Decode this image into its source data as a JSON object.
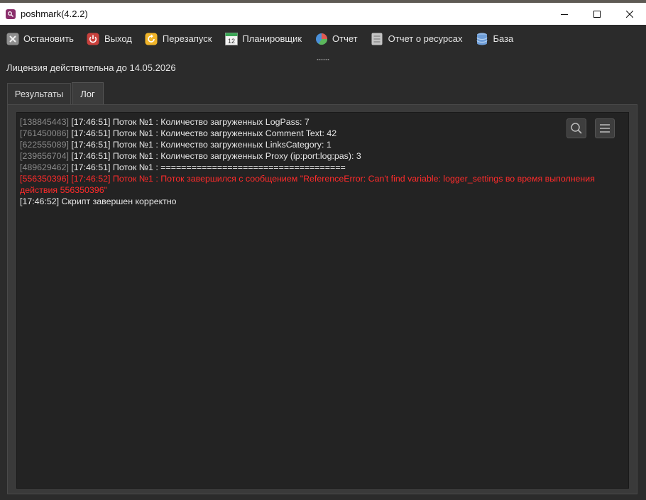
{
  "window": {
    "title": "poshmark(4.2.2)",
    "minimize_icon": "minimize-icon",
    "maximize_icon": "maximize-icon",
    "close_icon": "close-icon"
  },
  "toolbar": {
    "items": [
      {
        "label": "Остановить",
        "icon": "stop-icon",
        "color": "#9a9a9a"
      },
      {
        "label": "Выход",
        "icon": "power-icon",
        "color": "#d9534f"
      },
      {
        "label": "Перезапуск",
        "icon": "restart-icon",
        "color": "#f0b429"
      },
      {
        "label": "Планировщик",
        "icon": "calendar-icon",
        "color": "#3aa655"
      },
      {
        "label": "Отчет",
        "icon": "pie-chart-icon",
        "color": "#e05a4f"
      },
      {
        "label": "Отчет о ресурсах",
        "icon": "document-icon",
        "color": "#bdbdbd"
      },
      {
        "label": "База",
        "icon": "database-icon",
        "color": "#6f9ed8"
      }
    ]
  },
  "license_text": "Лицензия действительна до 14.05.2026",
  "tabs": [
    {
      "label": "Результаты",
      "active": false
    },
    {
      "label": "Лог",
      "active": true
    }
  ],
  "log": {
    "lines": [
      {
        "id": "[138845443]",
        "text": " [17:46:51] Поток №1 : Количество загруженных LogPass: 7",
        "type": "info"
      },
      {
        "id": "[761450086]",
        "text": " [17:46:51] Поток №1 : Количество загруженных Comment Text: 42",
        "type": "info"
      },
      {
        "id": "[622555089]",
        "text": " [17:46:51] Поток №1 : Количество загруженных LinksCategory: 1",
        "type": "info"
      },
      {
        "id": "[239656704]",
        "text": " [17:46:51] Поток №1 : Количество загруженных Proxy (ip:port:log:pas): 3",
        "type": "info"
      },
      {
        "id": "[489629462]",
        "text": " [17:46:51] Поток №1 : ====================================",
        "type": "info"
      },
      {
        "id": "[556350396]",
        "text": " [17:46:52] Поток №1 : Поток завершился с сообщением \"ReferenceError: Can't find variable: logger_settings во время выполнения действия 556350396\"",
        "type": "error"
      },
      {
        "id": "",
        "text": "[17:46:52] Скрипт завершен корректно",
        "type": "info"
      }
    ],
    "search_icon": "search-icon",
    "menu_icon": "menu-icon"
  }
}
